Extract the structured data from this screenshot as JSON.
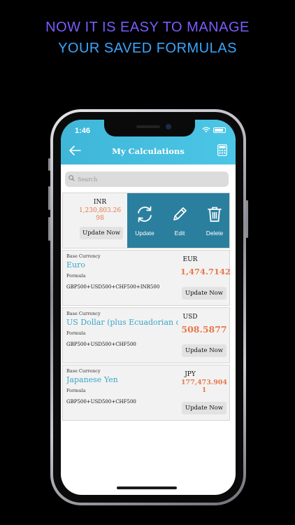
{
  "promo": {
    "line1": "NOW IT IS EASY TO MANAGE",
    "line2": "YOUR SAVED FORMULAS"
  },
  "status": {
    "time": "1:46"
  },
  "appbar": {
    "title": "My Calculations",
    "back_icon": "arrow-left-icon",
    "calc_icon": "calculator-icon"
  },
  "search": {
    "placeholder": "Search"
  },
  "swiped_item": {
    "code": "INR",
    "amount": "1,230,803.26 98",
    "update_label": "Update Now",
    "actions": [
      {
        "label": "Update",
        "icon": "refresh-icon"
      },
      {
        "label": "Edit",
        "icon": "pencil-icon"
      },
      {
        "label": "Delete",
        "icon": "trash-icon"
      }
    ]
  },
  "items": [
    {
      "base_label": "Base Currency",
      "name": "Euro",
      "formula_label": "Formula",
      "formula": "GBP500+USD500+CHF500+INR500",
      "code": "EUR",
      "amount": "1,474.7142",
      "update_label": "Update Now"
    },
    {
      "base_label": "Base Currency",
      "name": "US Dollar (plus Ecuadorian ce...",
      "formula_label": "Formula",
      "formula": "GBP500+USD500+CHF500",
      "code": "USD",
      "amount": "508.5877",
      "update_label": "Update Now"
    },
    {
      "base_label": "Base Currency",
      "name": "Japanese Yen",
      "formula_label": "Formula",
      "formula": "GBP500+USD500+CHF500",
      "code": "JPY",
      "amount": "177,473.904 1",
      "update_label": "Update Now"
    }
  ],
  "colors": {
    "accent": "#3fb6d8",
    "action_bg": "#2b7f9e",
    "amount": "#e8774a",
    "name": "#3aa6c6"
  }
}
